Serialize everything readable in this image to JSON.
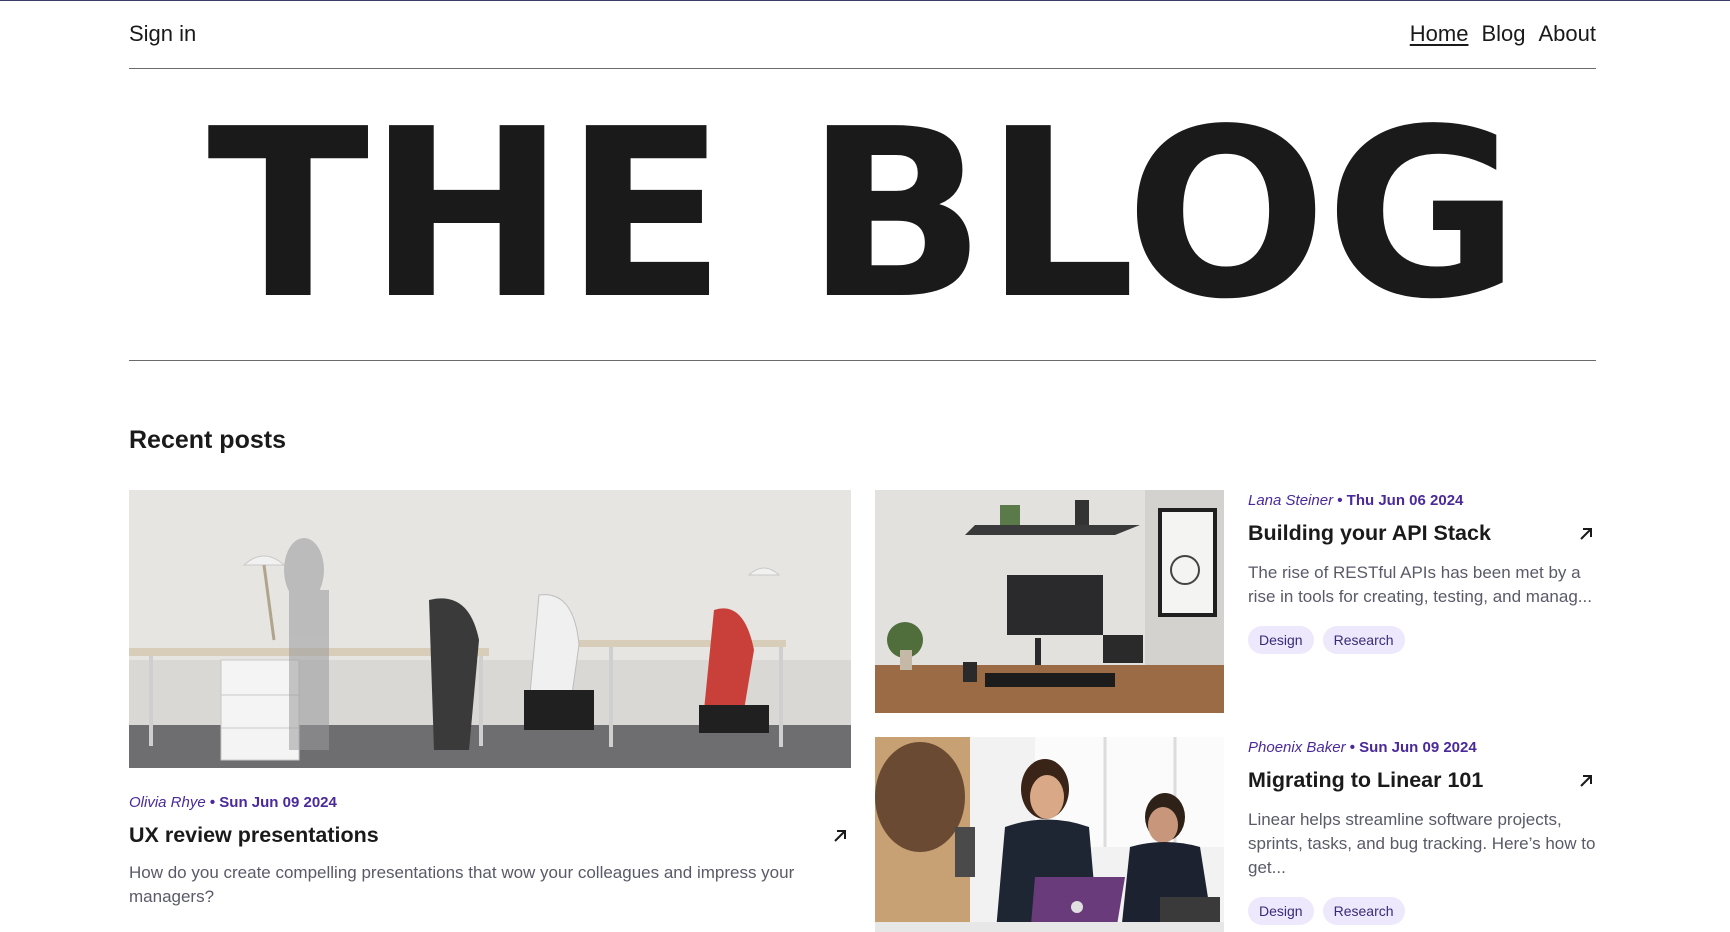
{
  "nav": {
    "signin": "Sign in",
    "links": [
      "Home",
      "Blog",
      "About"
    ]
  },
  "hero": {
    "title": "THE BLOG"
  },
  "section": {
    "title": "Recent posts"
  },
  "posts": [
    {
      "author": "Olivia Rhye",
      "date": "Sun Jun 09 2024",
      "title": "UX review presentations",
      "excerpt": "How do you create compelling presentations that wow your colleagues and impress your managers?",
      "image": "office-desks-photo",
      "tags": []
    },
    {
      "author": "Lana Steiner",
      "date": "Thu Jun 06 2024",
      "title": "Building your API Stack",
      "excerpt": "The rise of RESTful APIs has been met by a rise in tools for creating, testing, and manag...",
      "image": "monitor-desk-photo",
      "tags": [
        "Design",
        "Research"
      ]
    },
    {
      "author": "Phoenix Baker",
      "date": "Sun Jun 09 2024",
      "title": "Migrating to Linear 101",
      "excerpt": "Linear helps streamline software projects, sprints, tasks, and bug tracking. Here’s how to get...",
      "image": "team-laptop-photo",
      "tags": [
        "Design",
        "Research"
      ]
    }
  ],
  "meta_separator": " • ",
  "colors": {
    "accent": "#4a2a9a",
    "tag_bg": "#ede8fb",
    "text": "#1a1a1a",
    "muted": "#5a5a68"
  }
}
